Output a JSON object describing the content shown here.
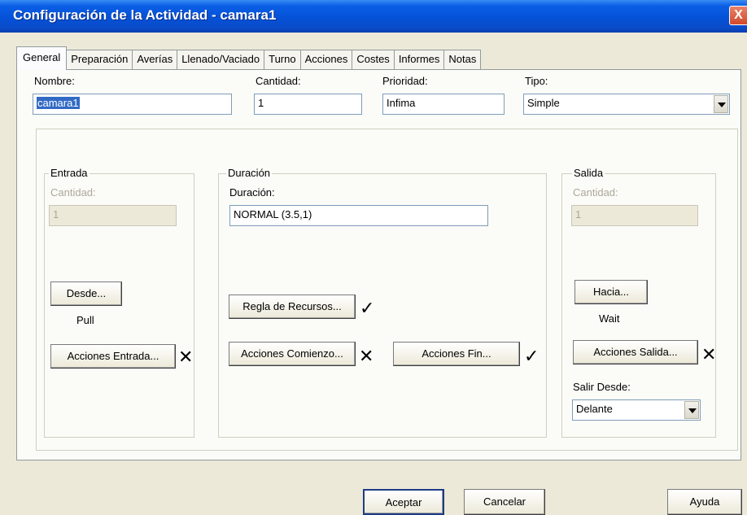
{
  "window": {
    "title": "Configuración de la Actividad - camara1",
    "close": "X"
  },
  "tabs": [
    "General",
    "Preparación",
    "Averías",
    "Llenado/Vaciado",
    "Turno",
    "Acciones",
    "Costes",
    "Informes",
    "Notas"
  ],
  "general": {
    "nombre_label": "Nombre:",
    "nombre_value": "camara1",
    "cantidad_label": "Cantidad:",
    "cantidad_value": "1",
    "prioridad_label": "Prioridad:",
    "prioridad_value": "Infima",
    "tipo_label": "Tipo:",
    "tipo_value": "Simple"
  },
  "entrada": {
    "legend": "Entrada",
    "cantidad_label": "Cantidad:",
    "cantidad_value": "1",
    "desde_button": "Desde...",
    "desde_status": "Pull",
    "acciones_button": "Acciones Entrada...",
    "acciones_mark": "✕"
  },
  "duracion": {
    "legend": "Duración",
    "label": "Duración:",
    "value": "NORMAL (3.5,1)",
    "regla_button": "Regla de Recursos...",
    "regla_mark": "✓",
    "comienzo_button": "Acciones Comienzo...",
    "comienzo_mark": "✕",
    "fin_button": "Acciones Fin...",
    "fin_mark": "✓"
  },
  "salida": {
    "legend": "Salida",
    "cantidad_label": "Cantidad:",
    "cantidad_value": "1",
    "hacia_button": "Hacia...",
    "hacia_status": "Wait",
    "acciones_button": "Acciones Salida...",
    "acciones_mark": "✕",
    "salir_label": "Salir Desde:",
    "salir_value": "Delante"
  },
  "footer": {
    "aceptar": "Aceptar",
    "cancelar": "Cancelar",
    "ayuda": "Ayuda"
  }
}
